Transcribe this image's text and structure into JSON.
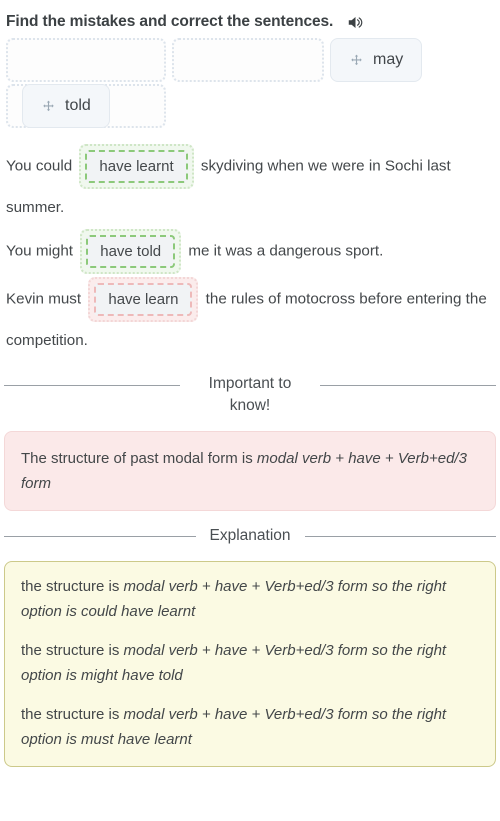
{
  "header": {
    "title": "Find the mistakes and correct the sentences.",
    "audio_icon": "speaker-icon"
  },
  "dnd": {
    "slots": [
      "",
      "",
      ""
    ],
    "tokens": [
      {
        "label": "may",
        "handle_icon": "move-arrows-icon"
      },
      {
        "label": "told",
        "handle_icon": "move-arrows-icon"
      }
    ]
  },
  "sentences": [
    {
      "before": "You could",
      "answer": "have learnt",
      "state": "correct",
      "after": "skydiving when we were in Sochi last summer."
    },
    {
      "before": "You might",
      "answer": "have told",
      "state": "correct",
      "after": "me it was a dangerous sport."
    },
    {
      "before": "Kevin must",
      "answer": "have learn",
      "state": "wrong",
      "after": "the rules of motocross before entering the competition."
    }
  ],
  "important": {
    "divider_label": "Important to know!",
    "text_plain": "The structure of past modal form is ",
    "text_italic": "modal verb + have + Verb+ed/3 form"
  },
  "explanation": {
    "divider_label": "Explanation",
    "lines": [
      {
        "lead": "the structure is ",
        "rule": "modal verb + have + Verb+ed/3 form so the right option is could have learnt"
      },
      {
        "lead": "the structure is ",
        "rule": "modal verb + have + Verb+ed/3 form so the right option is might have told"
      },
      {
        "lead": "the structure is ",
        "rule": "modal verb + have + Verb+ed/3 form so the right option is must have learnt"
      }
    ]
  },
  "colors": {
    "correct": "#8cc97a",
    "wrong": "#eeb9b9",
    "important_bg": "#fbe9e9",
    "explanation_bg": "#fbfae3",
    "text": "#44484b"
  }
}
